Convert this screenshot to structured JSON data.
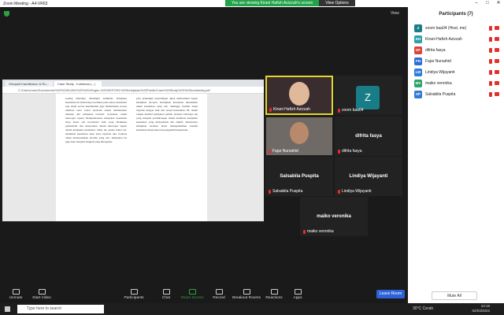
{
  "window": {
    "title": "Zoom Meeting - A4-VR63"
  },
  "banner": {
    "message": "You are viewing Kirani Hafizh Azizzah's screen",
    "view_options": "View Options"
  },
  "top": {
    "view_label": "View"
  },
  "browser": {
    "tabs": [
      "Ontopelt Kaudtbokon & Ro...",
      "Case Study - Indobesa (...)"
    ],
    "address": "C:/Users/user/Documents/%20%20KUNG%20%20/Degen.%20/KEPOR1%20Kebijakan%20Publik/Case%20Study%20%20Indobesity.pdf"
  },
  "doc": {
    "col1": "sedang dilandaju. Meskipun demikian, kebijakan kesehatan ini tidak hanya berfokus pada sektor kesehatan saja tetapi secara keseluruhan juga memerlukan proses multisas serta sosial ekonomi dalam memberikan dampak dan kebijakan tersebut. konsisten, untuk mencapai tujuan dlemplementasi kebijakan kesehatan tetap harus ada koordinasi baik yang dilakukan pemerintah dan masyarakat dalam mencapai tujuan dalam kebijakan kesehatan. Sehat itu, kedua faktor ini, kebijakan kesehatan akan terus berjalan dan evaluasi untuk menyesuaikan kondisi yang ada. Kebijakan ini juga akan menjadi langkah yang diterapkan.",
    "col2": "para pemangku kepentingan dapat memastikan tujuan kebijakan tercapai. Kebijakan kesehatan diusahakan untuk kesehatan yang ada. Sehingga kondisi dapat berjalan dengan baik dan sesuai kebutuhan. III. dalam rangka menilai kebijakan publik, terdapat beberapa hal yang menjadi pertimbangan dalam membuat kebijakan kesehatan yang menyeluruh dan efektif, diantaranya kebijakan tersebut harus memperhatikan kondisi kesehatan masyarakat dan pengambil keputusan."
  },
  "tiles": [
    {
      "name": "Kirani Hafizh Azizzah",
      "kind": "video"
    },
    {
      "name": "zoom baa04",
      "kind": "avatar",
      "initial": "Z"
    },
    {
      "name": "Fajar Nursahid",
      "kind": "video"
    },
    {
      "name": "difrita fasya",
      "kind": "text",
      "big": "difrita fasya"
    },
    {
      "name": "Salsabila Puspita",
      "kind": "text",
      "big": "Salsabila Puspita"
    },
    {
      "name": "Lindiya Wijayanti",
      "kind": "text",
      "big": "Lindiya Wijayanti"
    },
    {
      "name": "maiko veronika",
      "kind": "text",
      "big": "maiko veronika"
    }
  ],
  "toolbar": {
    "unmute": "Unmute",
    "start_video": "Start Video",
    "participants": "Participants",
    "chat": "Chat",
    "share_screen": "Share Screen",
    "record": "Record",
    "breakout": "Breakout Rooms",
    "reactions": "Reactions",
    "apps": "Apps",
    "leave": "Leave Room"
  },
  "panel": {
    "title": "Participants (7)",
    "people": [
      {
        "initials": "Z",
        "name": "zoom baa04 (Host, me)",
        "color": "#187d86"
      },
      {
        "initials": "KH",
        "name": "Kirani Hafizh Azizzah",
        "color": "#2ea0a8"
      },
      {
        "initials": "DF",
        "name": "difrita fasya",
        "color": "#d9453a"
      },
      {
        "initials": "FN",
        "name": "Fajar Nursahid",
        "color": "#2b6fd6"
      },
      {
        "initials": "LW",
        "name": "Lindiya Wijayanti",
        "color": "#2f7bd9"
      },
      {
        "initials": "MV",
        "name": "maiko veronika",
        "color": "#2ca46a"
      },
      {
        "initials": "SP",
        "name": "Salsabila Puspita",
        "color": "#2f7bd9"
      }
    ],
    "mute_all": "Mute All"
  },
  "taskbar": {
    "search": "Type here to search",
    "weather": "30°C Cerah",
    "time": "10:18",
    "date": "02/03/2022"
  }
}
